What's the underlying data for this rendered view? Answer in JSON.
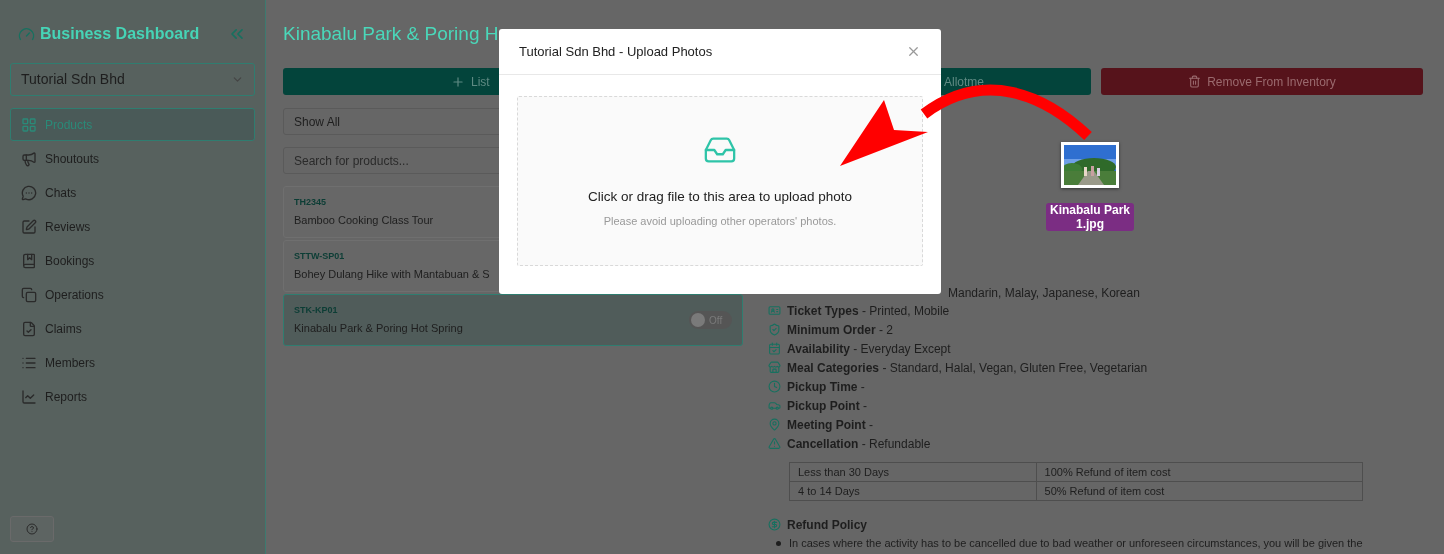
{
  "sidebar": {
    "title": "Business Dashboard",
    "company_select": {
      "value": "Tutorial Sdn Bhd"
    },
    "items": [
      {
        "label": "Products",
        "selected": true
      },
      {
        "label": "Shoutouts",
        "selected": false
      },
      {
        "label": "Chats",
        "selected": false
      },
      {
        "label": "Reviews",
        "selected": false
      },
      {
        "label": "Bookings",
        "selected": false
      },
      {
        "label": "Operations",
        "selected": false
      },
      {
        "label": "Claims",
        "selected": false
      },
      {
        "label": "Members",
        "selected": false
      },
      {
        "label": "Reports",
        "selected": false
      }
    ]
  },
  "main": {
    "title": "Kinabalu Park & Poring H",
    "actions": [
      {
        "kind": "primary",
        "label": "List"
      },
      {
        "kind": "primary",
        "label": "Allotme"
      },
      {
        "kind": "danger",
        "label": "Remove From Inventory"
      }
    ],
    "filter_select": {
      "value": "Show All"
    },
    "search": {
      "placeholder": "Search for products..."
    },
    "products": [
      {
        "code": "TH2345",
        "name": "Bamboo Cooking Class Tour",
        "selected": false
      },
      {
        "code": "STTW-SP01",
        "name": "Bohey Dulang Hike with Mantabuan & S",
        "selected": false
      },
      {
        "code": "STK-KP01",
        "name": "Kinabalu Park & Poring Hot Spring",
        "selected": true,
        "toggle": {
          "on": false,
          "label": "Off"
        }
      }
    ],
    "details": [
      {
        "text": "Mandarin, Malay, Japanese, Korean"
      },
      {
        "text": "**Ticket Types** - Printed, Mobile"
      },
      {
        "text": "**Minimum Order** - 2"
      },
      {
        "text": "**Availability** - Everyday Except"
      },
      {
        "text": "**Meal Categories** - Standard, Halal, Vegan, Gluten Free, Vegetarian"
      },
      {
        "text": "**Pickup Time** -"
      },
      {
        "text": "**Pickup Point** -"
      },
      {
        "text": "**Meeting Point** -"
      },
      {
        "text": "**Cancellation** - Refundable"
      }
    ],
    "cancellation_table": [
      [
        "Less than 30 Days",
        "100% Refund of item cost"
      ],
      [
        "4 to 14 Days",
        "50% Refund of item cost"
      ]
    ],
    "refund_policy": {
      "title": "Refund Policy",
      "bullets": [
        "In cases where the activity has to be cancelled due to bad weather or unforeseen circumstances, you will be given the"
      ]
    }
  },
  "modal": {
    "title": "Tutorial Sdn Bhd - Upload Photos",
    "prompt": "Click or drag file to this area to upload photo",
    "hint": "Please avoid uploading other operators' photos."
  },
  "desktop_file": {
    "name": "Kinabalu Park 1.jpg"
  }
}
